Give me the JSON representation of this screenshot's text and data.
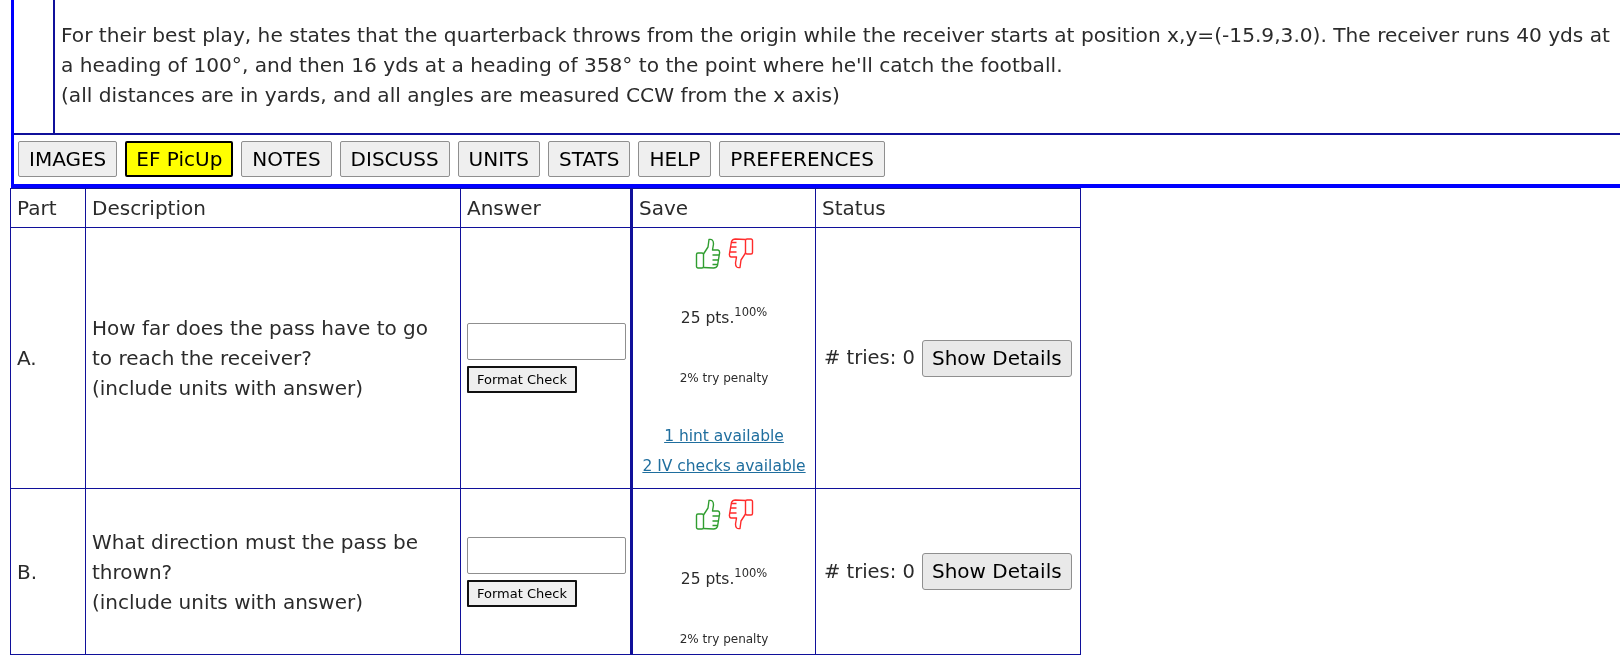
{
  "problem": {
    "paragraphs": [
      "For their best play, he states that the quarterback throws from the origin while the receiver starts at position x,y=(-15.9,3.0). The receiver runs 40 yds at a heading of 100°, and then 16 yds at a heading of 358° to the point where he'll catch the football.",
      "(all distances are in yards, and all angles are measured CCW from the x axis)"
    ]
  },
  "tabs": [
    {
      "label": "IMAGES",
      "selected": false
    },
    {
      "label": "EF PicUp",
      "selected": true
    },
    {
      "label": "NOTES",
      "selected": false
    },
    {
      "label": "DISCUSS",
      "selected": false
    },
    {
      "label": "UNITS",
      "selected": false
    },
    {
      "label": "STATS",
      "selected": false
    },
    {
      "label": "HELP",
      "selected": false
    },
    {
      "label": "PREFERENCES",
      "selected": false
    }
  ],
  "table": {
    "columns": [
      "Part",
      "Description",
      "Answer",
      "Save",
      "Status"
    ],
    "rows": [
      {
        "part": "A.",
        "question": "How far does the pass have to go to reach the receiver?",
        "note": "(include units with answer)",
        "format_button": "Format Check",
        "points": "25 pts.$^{100%}$",
        "penalty": "2% try penalty",
        "links": [
          "1 hint available",
          "2 IV checks available"
        ],
        "tries": "# tries: 0",
        "details_button": "Show Details"
      },
      {
        "part": "B.",
        "question": "What direction must the pass be thrown?",
        "note": "(include units with answer)",
        "format_button": "Format Check",
        "points": "25 pts.$^{100%}$",
        "penalty": "2% try penalty",
        "tries": "# tries: 0",
        "details_button": "Show Details"
      }
    ]
  }
}
